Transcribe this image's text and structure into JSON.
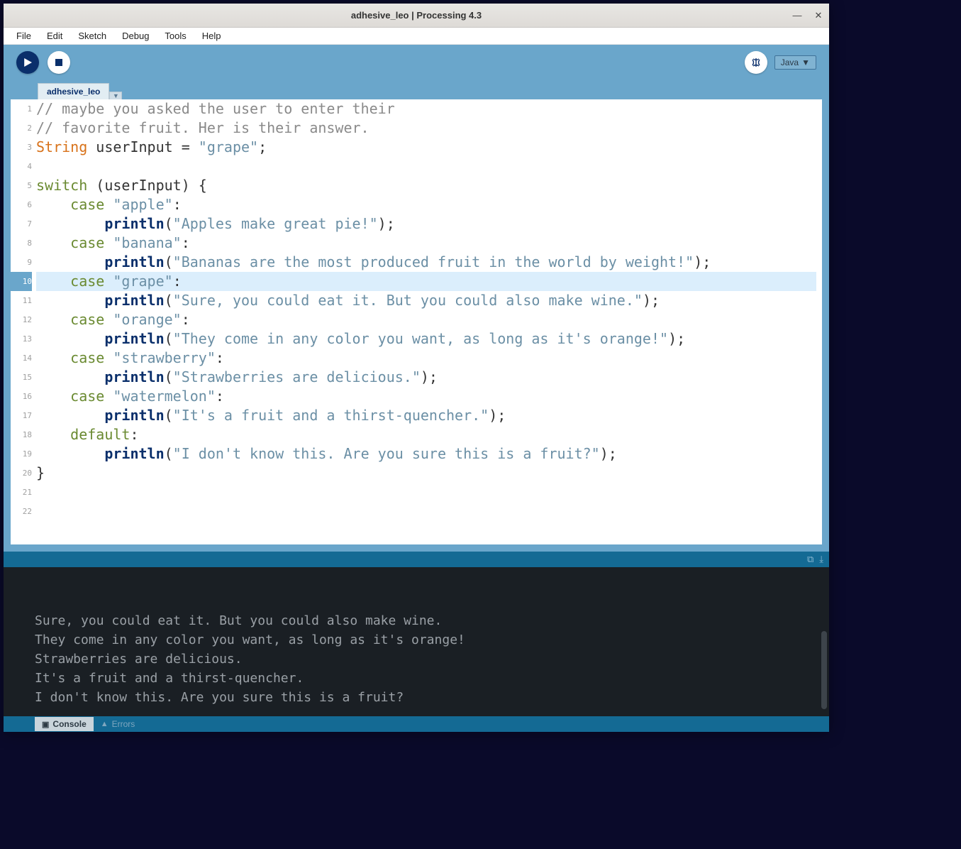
{
  "window": {
    "title": "adhesive_leo | Processing 4.3"
  },
  "menubar": [
    "File",
    "Edit",
    "Sketch",
    "Debug",
    "Tools",
    "Help"
  ],
  "toolbar": {
    "mode_label": "Java"
  },
  "tabs": {
    "active": "adhesive_leo"
  },
  "editor": {
    "highlighted_line": 10,
    "lines": [
      {
        "n": 1,
        "tokens": [
          {
            "c": "tok-comment",
            "t": "// maybe you asked the user to enter their"
          }
        ]
      },
      {
        "n": 2,
        "tokens": [
          {
            "c": "tok-comment",
            "t": "// favorite fruit. Her is their answer."
          }
        ]
      },
      {
        "n": 3,
        "tokens": [
          {
            "c": "tok-type",
            "t": "String"
          },
          {
            "c": "tok-plain",
            "t": " userInput = "
          },
          {
            "c": "tok-str",
            "t": "\"grape\""
          },
          {
            "c": "tok-plain",
            "t": ";"
          }
        ]
      },
      {
        "n": 4,
        "tokens": []
      },
      {
        "n": 5,
        "tokens": [
          {
            "c": "tok-keyword",
            "t": "switch"
          },
          {
            "c": "tok-plain",
            "t": " (userInput) {"
          }
        ]
      },
      {
        "n": 6,
        "tokens": [
          {
            "c": "tok-plain",
            "t": "    "
          },
          {
            "c": "tok-keyword",
            "t": "case"
          },
          {
            "c": "tok-plain",
            "t": " "
          },
          {
            "c": "tok-str",
            "t": "\"apple\""
          },
          {
            "c": "tok-plain",
            "t": ":"
          }
        ]
      },
      {
        "n": 7,
        "tokens": [
          {
            "c": "tok-plain",
            "t": "        "
          },
          {
            "c": "tok-func",
            "t": "println"
          },
          {
            "c": "tok-plain",
            "t": "("
          },
          {
            "c": "tok-str",
            "t": "\"Apples make great pie!\""
          },
          {
            "c": "tok-plain",
            "t": ");"
          }
        ]
      },
      {
        "n": 8,
        "tokens": [
          {
            "c": "tok-plain",
            "t": "    "
          },
          {
            "c": "tok-keyword",
            "t": "case"
          },
          {
            "c": "tok-plain",
            "t": " "
          },
          {
            "c": "tok-str",
            "t": "\"banana\""
          },
          {
            "c": "tok-plain",
            "t": ":"
          }
        ]
      },
      {
        "n": 9,
        "tokens": [
          {
            "c": "tok-plain",
            "t": "        "
          },
          {
            "c": "tok-func",
            "t": "println"
          },
          {
            "c": "tok-plain",
            "t": "("
          },
          {
            "c": "tok-str",
            "t": "\"Bananas are the most produced fruit in the world by weight!\""
          },
          {
            "c": "tok-plain",
            "t": ");"
          }
        ]
      },
      {
        "n": 10,
        "tokens": [
          {
            "c": "tok-plain",
            "t": "    "
          },
          {
            "c": "tok-keyword",
            "t": "case"
          },
          {
            "c": "tok-plain",
            "t": " "
          },
          {
            "c": "tok-str",
            "t": "\"grape\""
          },
          {
            "c": "tok-plain",
            "t": ":"
          }
        ]
      },
      {
        "n": 11,
        "tokens": [
          {
            "c": "tok-plain",
            "t": "        "
          },
          {
            "c": "tok-func",
            "t": "println"
          },
          {
            "c": "tok-plain",
            "t": "("
          },
          {
            "c": "tok-str",
            "t": "\"Sure, you could eat it. But you could also make wine.\""
          },
          {
            "c": "tok-plain",
            "t": ");"
          }
        ]
      },
      {
        "n": 12,
        "tokens": [
          {
            "c": "tok-plain",
            "t": "    "
          },
          {
            "c": "tok-keyword",
            "t": "case"
          },
          {
            "c": "tok-plain",
            "t": " "
          },
          {
            "c": "tok-str",
            "t": "\"orange\""
          },
          {
            "c": "tok-plain",
            "t": ":"
          }
        ]
      },
      {
        "n": 13,
        "tokens": [
          {
            "c": "tok-plain",
            "t": "        "
          },
          {
            "c": "tok-func",
            "t": "println"
          },
          {
            "c": "tok-plain",
            "t": "("
          },
          {
            "c": "tok-str",
            "t": "\"They come in any color you want, as long as it's orange!\""
          },
          {
            "c": "tok-plain",
            "t": ");"
          }
        ]
      },
      {
        "n": 14,
        "tokens": [
          {
            "c": "tok-plain",
            "t": "    "
          },
          {
            "c": "tok-keyword",
            "t": "case"
          },
          {
            "c": "tok-plain",
            "t": " "
          },
          {
            "c": "tok-str",
            "t": "\"strawberry\""
          },
          {
            "c": "tok-plain",
            "t": ":"
          }
        ]
      },
      {
        "n": 15,
        "tokens": [
          {
            "c": "tok-plain",
            "t": "        "
          },
          {
            "c": "tok-func",
            "t": "println"
          },
          {
            "c": "tok-plain",
            "t": "("
          },
          {
            "c": "tok-str",
            "t": "\"Strawberries are delicious.\""
          },
          {
            "c": "tok-plain",
            "t": ");"
          }
        ]
      },
      {
        "n": 16,
        "tokens": [
          {
            "c": "tok-plain",
            "t": "    "
          },
          {
            "c": "tok-keyword",
            "t": "case"
          },
          {
            "c": "tok-plain",
            "t": " "
          },
          {
            "c": "tok-str",
            "t": "\"watermelon\""
          },
          {
            "c": "tok-plain",
            "t": ":"
          }
        ]
      },
      {
        "n": 17,
        "tokens": [
          {
            "c": "tok-plain",
            "t": "        "
          },
          {
            "c": "tok-func",
            "t": "println"
          },
          {
            "c": "tok-plain",
            "t": "("
          },
          {
            "c": "tok-str",
            "t": "\"It's a fruit and a thirst-quencher.\""
          },
          {
            "c": "tok-plain",
            "t": ");"
          }
        ]
      },
      {
        "n": 18,
        "tokens": [
          {
            "c": "tok-plain",
            "t": "    "
          },
          {
            "c": "tok-keyword",
            "t": "default"
          },
          {
            "c": "tok-plain",
            "t": ":"
          }
        ]
      },
      {
        "n": 19,
        "tokens": [
          {
            "c": "tok-plain",
            "t": "        "
          },
          {
            "c": "tok-func",
            "t": "println"
          },
          {
            "c": "tok-plain",
            "t": "("
          },
          {
            "c": "tok-str",
            "t": "\"I don't know this. Are you sure this is a fruit?\""
          },
          {
            "c": "tok-plain",
            "t": ");"
          }
        ]
      },
      {
        "n": 20,
        "tokens": [
          {
            "c": "tok-plain",
            "t": "}"
          }
        ]
      },
      {
        "n": 21,
        "tokens": []
      },
      {
        "n": 22,
        "tokens": []
      }
    ]
  },
  "console": {
    "lines": [
      "Sure, you could eat it. But you could also make wine.",
      "They come in any color you want, as long as it's orange!",
      "Strawberries are delicious.",
      "It's a fruit and a thirst-quencher.",
      "I don't know this. Are you sure this is a fruit?"
    ]
  },
  "bottom_tabs": {
    "console": "Console",
    "errors": "Errors"
  }
}
